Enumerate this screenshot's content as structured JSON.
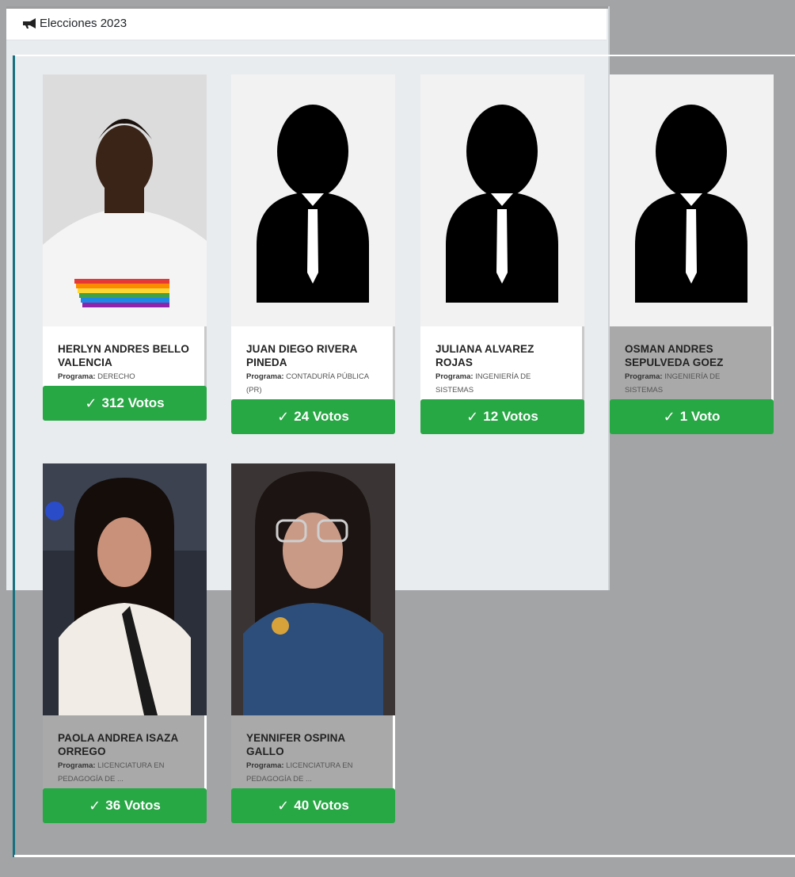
{
  "header": {
    "title": "Elecciones 2023",
    "icon": "megaphone-icon"
  },
  "program_label": "Programa:",
  "candidates": [
    {
      "name": "HERLYN ANDRES BELLO VALENCIA",
      "program": "DERECHO",
      "votes": "312 Votos",
      "photo": "person-photo"
    },
    {
      "name": "JUAN DIEGO RIVERA PINEDA",
      "program": "CONTADURÍA PÚBLICA (PR)",
      "votes": "24 Votos",
      "photo": "placeholder-avatar"
    },
    {
      "name": "JULIANA ALVAREZ ROJAS",
      "program": "INGENIERÍA DE SISTEMAS",
      "votes": "12 Votos",
      "photo": "placeholder-avatar"
    },
    {
      "name": "OSMAN ANDRES SEPULVEDA GOEZ",
      "program": "INGENIERÍA DE SISTEMAS",
      "votes": "1 Voto",
      "photo": "placeholder-avatar"
    },
    {
      "name": "PAOLA ANDREA ISAZA ORREGO",
      "program": "LICENCIATURA EN PEDAGOGÍA DE ...",
      "votes": "36 Votos",
      "photo": "person-photo"
    },
    {
      "name": "YENNIFER OSPINA GALLO",
      "program": "LICENCIATURA EN PEDAGOGÍA DE ...",
      "votes": "40 Votos",
      "photo": "person-photo"
    }
  ],
  "colors": {
    "vote_button": "#28a745",
    "accent": "#17707f",
    "overlay": "#a2a4a6"
  }
}
